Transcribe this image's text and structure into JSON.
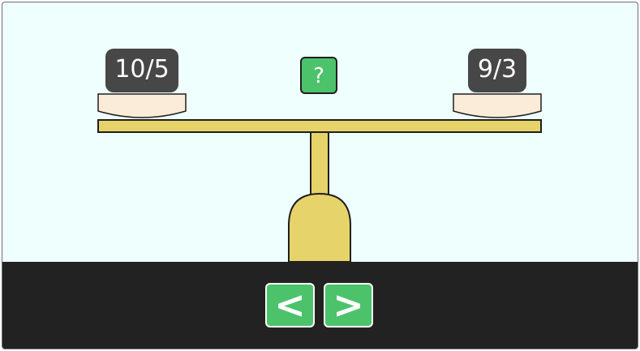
{
  "scale": {
    "left_weight": "10/5",
    "right_weight": "9/3",
    "compare_label": "?"
  },
  "navigation": {
    "prev_label": "<",
    "next_label": ">"
  },
  "colors": {
    "background": "#effffe",
    "beam": "#e6d46a",
    "pan": "#fbebd9",
    "weight_box": "#474747",
    "button": "#4cc36b",
    "bottom_bar": "#222222"
  }
}
